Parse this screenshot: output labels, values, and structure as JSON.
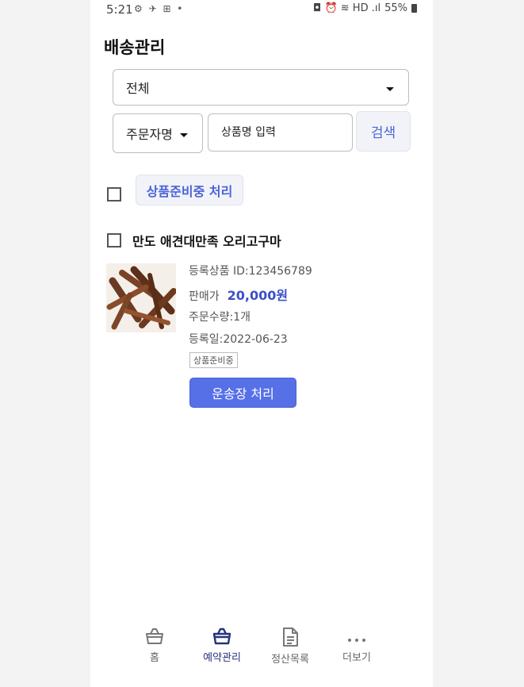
{
  "status_bar": {
    "time": "5:21",
    "left_icons": "⚙ ✈ ⊞ •",
    "battery": "55%",
    "right_icons": "◘ ⏰ ≋ HD .ıl"
  },
  "page_title": "배송관리",
  "filters": {
    "status_select": "전체",
    "search_type": "주문자명",
    "search_placeholder": "상품명 입력",
    "search_button": "검색"
  },
  "bulk_action": {
    "label": "상품준비중 처리"
  },
  "order": {
    "product_name": "만도 애견대만족 오리고구마",
    "registered_id": "등록상품 ID:123456789",
    "price_label": "판매가",
    "price_value": "20,000원",
    "quantity": "주문수량:1개",
    "date": "등록일:2022-06-23",
    "status": "상품준비중",
    "ship_button": "운송장 처리"
  },
  "bottom_nav": [
    {
      "label": "홈",
      "icon": "basket-icon",
      "active": false
    },
    {
      "label": "예약관리",
      "icon": "basket-icon",
      "active": true
    },
    {
      "label": "정산목록",
      "icon": "document-icon",
      "active": false
    },
    {
      "label": "더보기",
      "icon": "more-dots-icon",
      "active": false
    }
  ],
  "colors": {
    "accent": "#4a63d8",
    "button_primary": "#5670e8",
    "nav_active": "#26337a"
  }
}
